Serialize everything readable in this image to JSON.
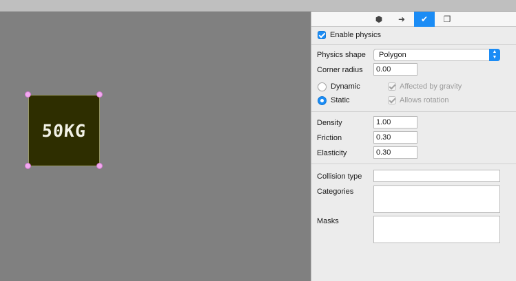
{
  "canvas": {
    "sprite": {
      "text": "50KG",
      "fill_color": "#2e2e00",
      "handle_color": "#f3a9f0"
    }
  },
  "panel": {
    "tabs": [
      {
        "icon": "node-icon",
        "glyph": "⬢",
        "active": false
      },
      {
        "icon": "arrow-right-circle-icon",
        "glyph": "➜",
        "active": false
      },
      {
        "icon": "physics-icon",
        "glyph": "✔",
        "active": true
      },
      {
        "icon": "layers-icon",
        "glyph": "❐",
        "active": false
      }
    ],
    "enable_physics": {
      "label": "Enable physics",
      "checked": true
    },
    "physics_shape": {
      "label": "Physics shape",
      "value": "Polygon"
    },
    "corner_radius": {
      "label": "Corner radius",
      "value": "0.00"
    },
    "body_type": {
      "dynamic": {
        "label": "Dynamic",
        "selected": false
      },
      "static": {
        "label": "Static",
        "selected": true
      }
    },
    "affected_by_gravity": {
      "label": "Affected by gravity",
      "checked": true,
      "enabled": false
    },
    "allows_rotation": {
      "label": "Allows rotation",
      "checked": true,
      "enabled": false
    },
    "density": {
      "label": "Density",
      "value": "1.00"
    },
    "friction": {
      "label": "Friction",
      "value": "0.30"
    },
    "elasticity": {
      "label": "Elasticity",
      "value": "0.30"
    },
    "collision_type": {
      "label": "Collision type",
      "value": ""
    },
    "categories": {
      "label": "Categories",
      "value": ""
    },
    "masks": {
      "label": "Masks",
      "value": ""
    },
    "accent_color": "#1b8cf5"
  }
}
